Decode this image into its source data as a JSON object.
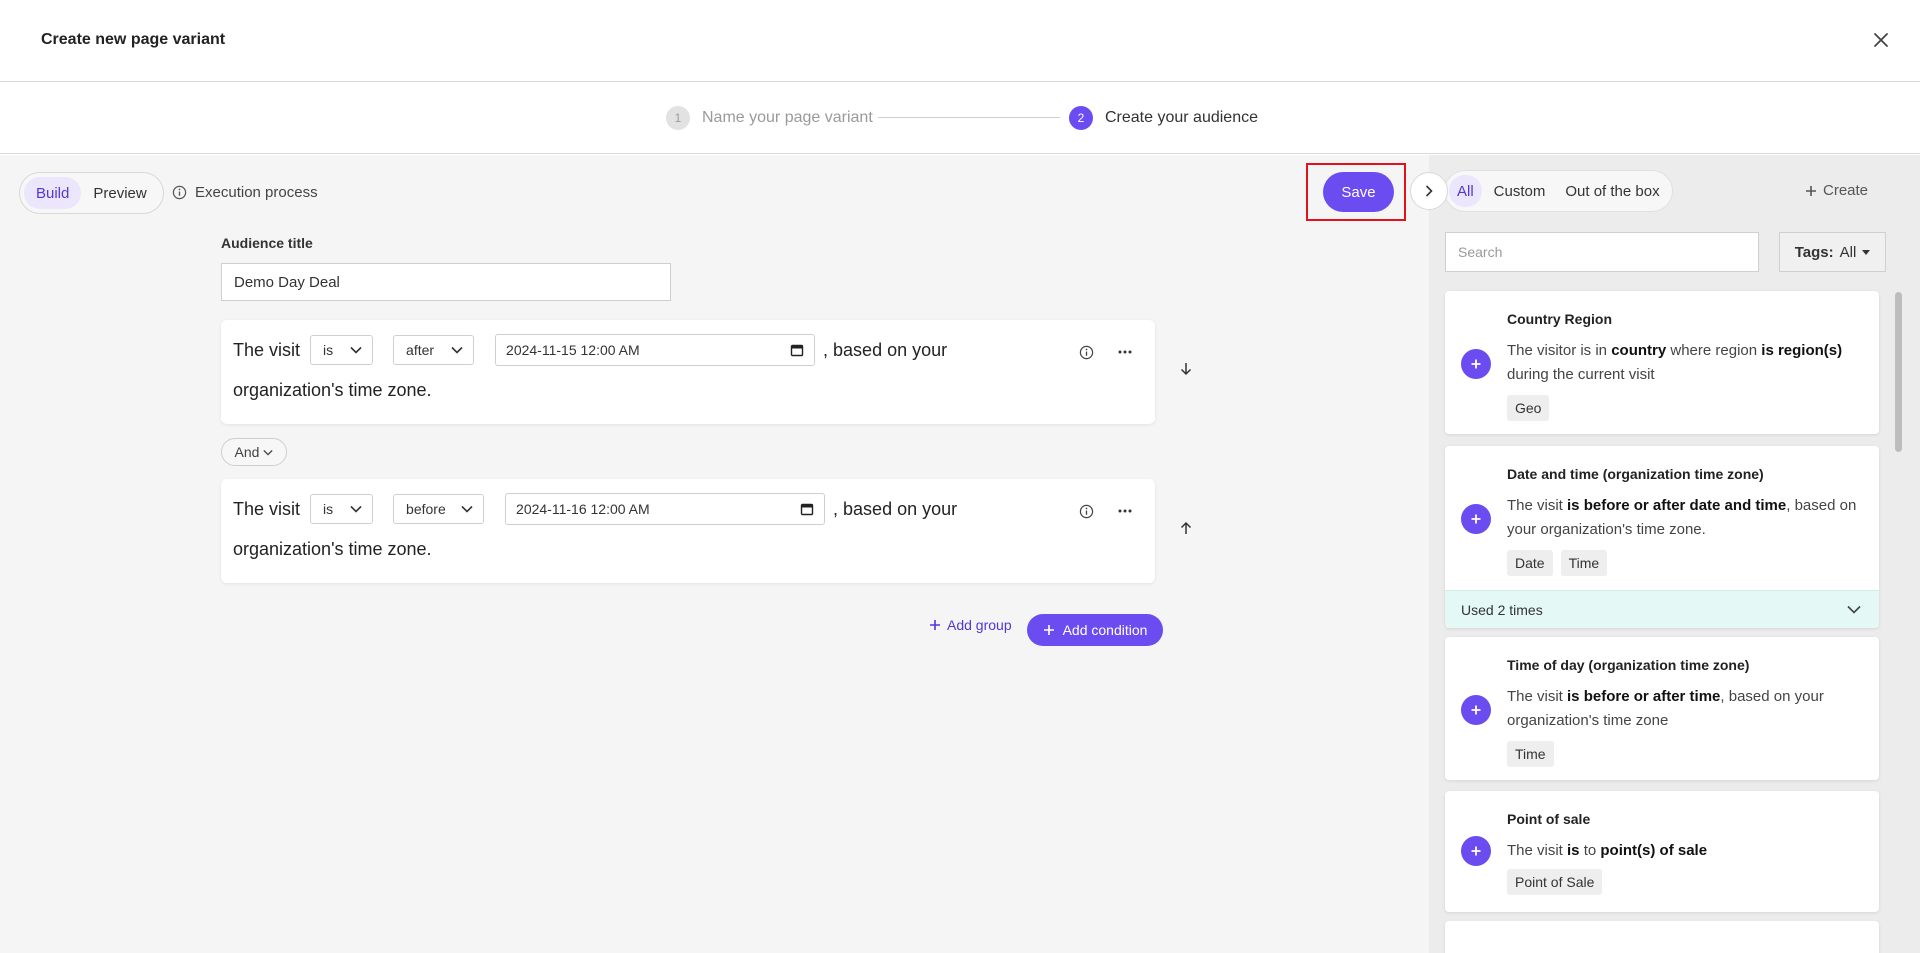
{
  "header": {
    "title": "Create new page variant"
  },
  "stepper": {
    "step1": {
      "num": "1",
      "label": "Name your page variant"
    },
    "step2": {
      "num": "2",
      "label": "Create your audience"
    }
  },
  "toolbar": {
    "build_label": "Build",
    "preview_label": "Preview",
    "execution_label": "Execution process",
    "save_label": "Save"
  },
  "audience": {
    "title_label": "Audience title",
    "title_value": "Demo Day Deal"
  },
  "conditions": [
    {
      "prefix": "The visit",
      "op": "is",
      "relation": "after",
      "datetime": "2024-11-15 12:00  AM",
      "suffix": ", based on your",
      "line2": "organization's time zone."
    },
    {
      "prefix": "The visit",
      "op": "is",
      "relation": "before",
      "datetime": "2024-11-16 12:00  AM",
      "suffix": ", based on your",
      "line2": "organization's time zone."
    }
  ],
  "connector": {
    "label": "And"
  },
  "actions": {
    "add_group": "Add group",
    "add_condition": "Add condition"
  },
  "library": {
    "tabs": [
      "All",
      "Custom",
      "Out of the box"
    ],
    "create_label": "Create",
    "search_placeholder": "Search",
    "tags_label": "Tags:",
    "tags_value": "All",
    "cards": [
      {
        "title": "Country Region",
        "desc": [
          {
            "t": "The visitor is in ",
            "b": false
          },
          {
            "t": "country",
            "b": true
          },
          {
            "t": " where region ",
            "b": false
          },
          {
            "t": "is region(s)",
            "b": true
          },
          {
            "t": " during the current visit",
            "b": false
          }
        ],
        "tags": [
          "Geo"
        ]
      },
      {
        "title": "Date and time (organization time zone)",
        "desc": [
          {
            "t": "The visit ",
            "b": false
          },
          {
            "t": "is before or after date and time",
            "b": true
          },
          {
            "t": ", based on your organization's time zone.",
            "b": false
          }
        ],
        "tags": [
          "Date",
          "Time"
        ],
        "used": "Used 2 times"
      },
      {
        "title": "Time of day (organization time zone)",
        "desc": [
          {
            "t": "The visit ",
            "b": false
          },
          {
            "t": "is before or after time",
            "b": true
          },
          {
            "t": ", based on your organization's time zone",
            "b": false
          }
        ],
        "tags": [
          "Time"
        ]
      },
      {
        "title": "Point of sale",
        "desc": [
          {
            "t": "The visit ",
            "b": false
          },
          {
            "t": "is",
            "b": true
          },
          {
            "t": " to ",
            "b": false
          },
          {
            "t": "point(s) of sale",
            "b": true
          }
        ],
        "tags": [
          "Point of Sale"
        ]
      }
    ]
  },
  "colors": {
    "accent": "#6b4cf0",
    "highlight": "#e0121a"
  }
}
